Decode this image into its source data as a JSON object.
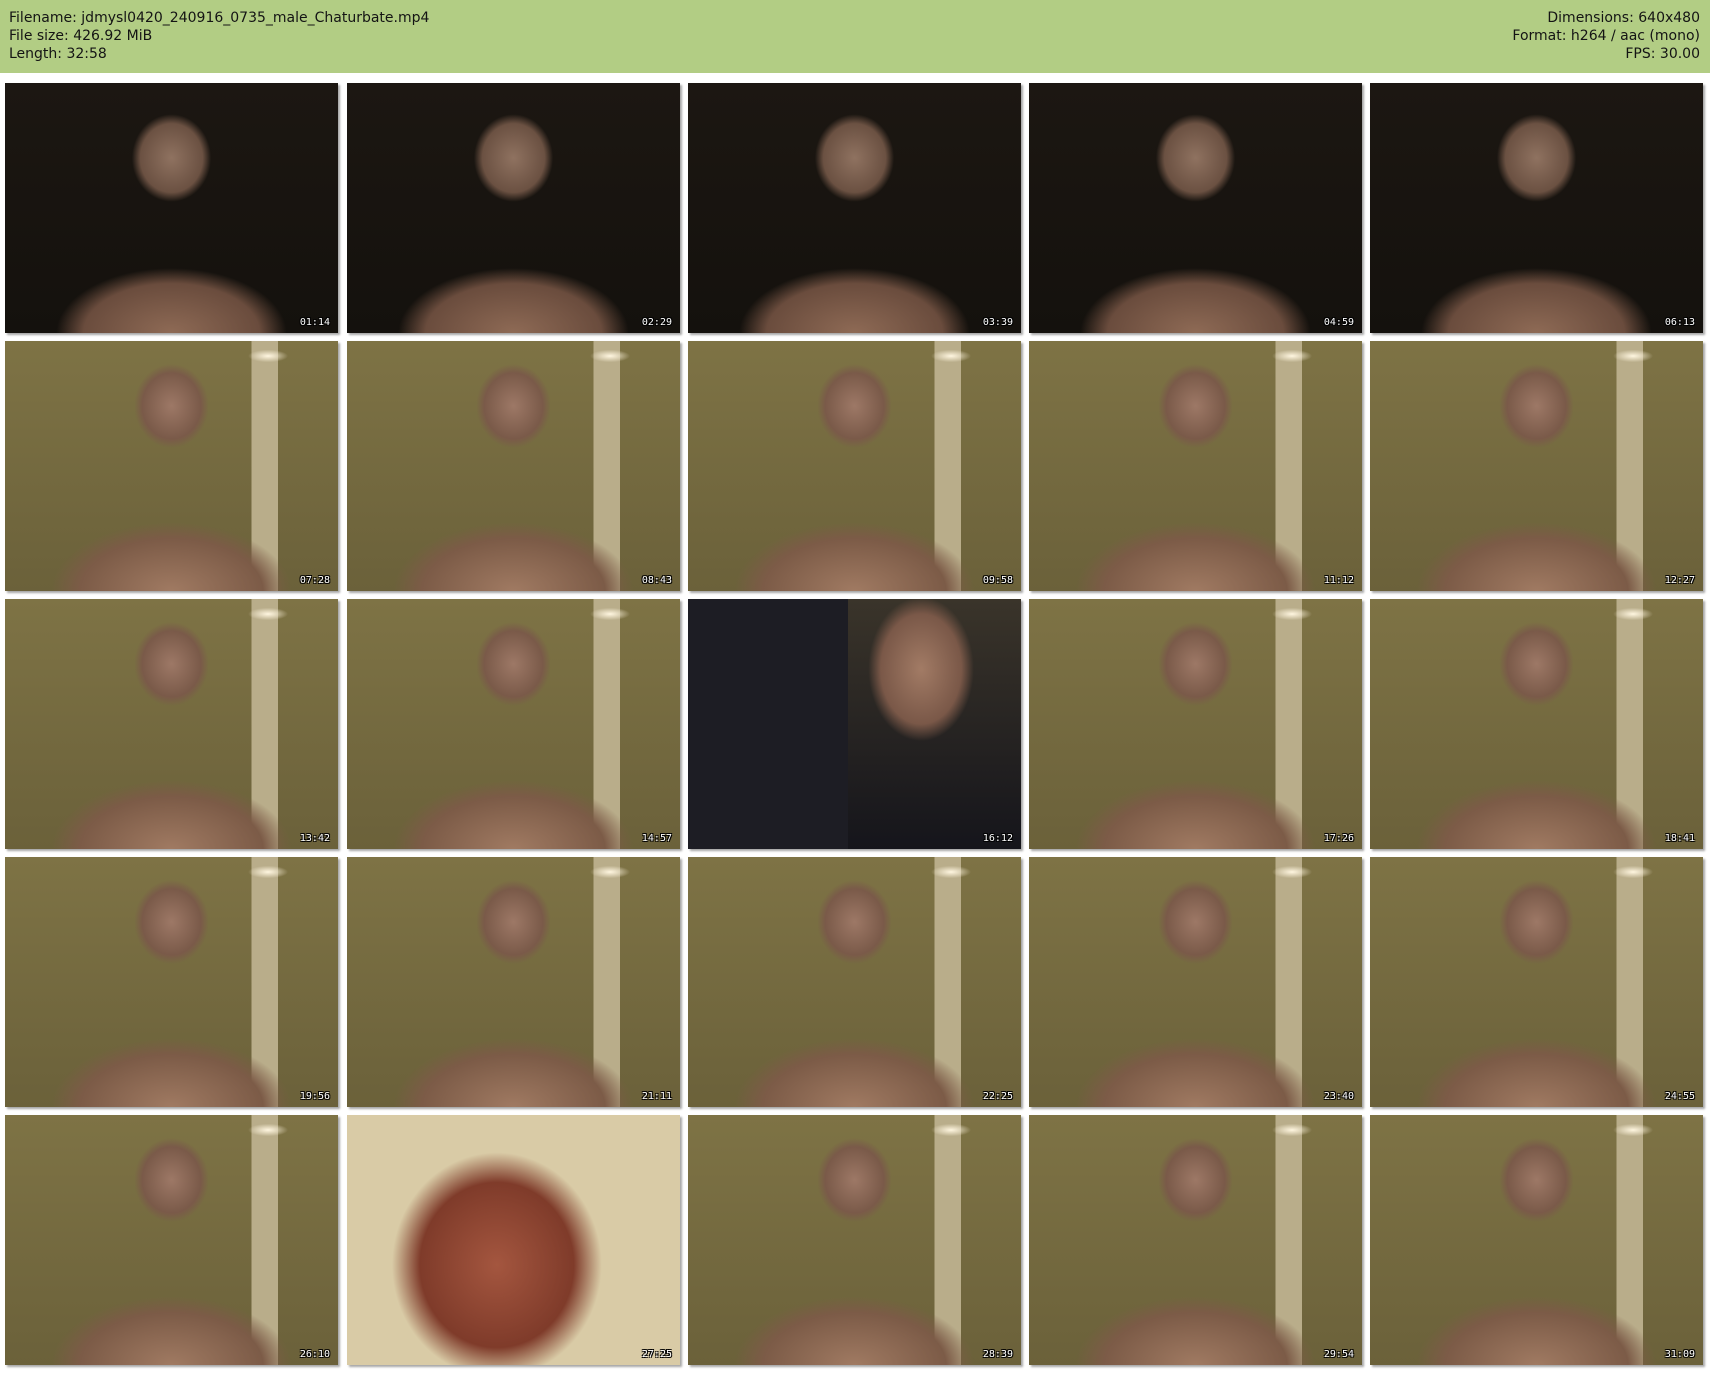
{
  "header": {
    "filename_line": "Filename: jdmysl0420_240916_0735_male_Chaturbate.mp4",
    "filesize_line": "File size: 426.92 MiB",
    "length_line": "Length: 32:58",
    "dimensions_line": "Dimensions: 640x480",
    "format_line": "Format: h264 / aac (mono)",
    "fps_line": "FPS: 30.00",
    "background_color": "#b2cd84"
  },
  "thumbnails": [
    {
      "timestamp": "01:14",
      "scene": "dark"
    },
    {
      "timestamp": "02:29",
      "scene": "dark"
    },
    {
      "timestamp": "03:39",
      "scene": "dark"
    },
    {
      "timestamp": "04:59",
      "scene": "dark"
    },
    {
      "timestamp": "06:13",
      "scene": "dark"
    },
    {
      "timestamp": "07:28",
      "scene": "room"
    },
    {
      "timestamp": "08:43",
      "scene": "room"
    },
    {
      "timestamp": "09:58",
      "scene": "room"
    },
    {
      "timestamp": "11:12",
      "scene": "room"
    },
    {
      "timestamp": "12:27",
      "scene": "room"
    },
    {
      "timestamp": "13:42",
      "scene": "room"
    },
    {
      "timestamp": "14:57",
      "scene": "room"
    },
    {
      "timestamp": "16:12",
      "scene": "stand"
    },
    {
      "timestamp": "17:26",
      "scene": "room"
    },
    {
      "timestamp": "18:41",
      "scene": "room"
    },
    {
      "timestamp": "19:56",
      "scene": "room"
    },
    {
      "timestamp": "21:11",
      "scene": "room"
    },
    {
      "timestamp": "22:25",
      "scene": "room"
    },
    {
      "timestamp": "23:40",
      "scene": "room"
    },
    {
      "timestamp": "24:55",
      "scene": "room"
    },
    {
      "timestamp": "26:10",
      "scene": "room"
    },
    {
      "timestamp": "27:25",
      "scene": "close"
    },
    {
      "timestamp": "28:39",
      "scene": "room"
    },
    {
      "timestamp": "29:54",
      "scene": "room"
    },
    {
      "timestamp": "31:09",
      "scene": "room"
    }
  ]
}
